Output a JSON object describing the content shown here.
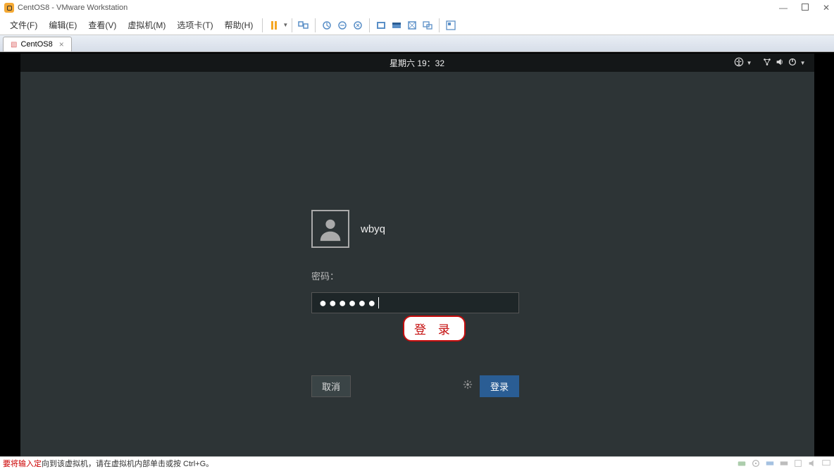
{
  "window": {
    "title": "CentOS8 - VMware Workstation",
    "minimize": "—",
    "close": "✕"
  },
  "menubar": {
    "file": "文件(F)",
    "edit": "编辑(E)",
    "view": "查看(V)",
    "vm": "虚拟机(M)",
    "tabs": "选项卡(T)",
    "help": "帮助(H)"
  },
  "tab": {
    "label": "CentOS8",
    "close": "×"
  },
  "gnome": {
    "clock": "星期六 19：32"
  },
  "login": {
    "username": "wbyq",
    "password_label": "密码：",
    "password_masked": "●●●●●●",
    "callout": "登 录",
    "cancel": "取消",
    "submit": "登录"
  },
  "statusbar": {
    "red_prefix": "要将输入定",
    "rest": "向到该虚拟机，请在虚拟机内部单击或按 Ctrl+G。"
  }
}
